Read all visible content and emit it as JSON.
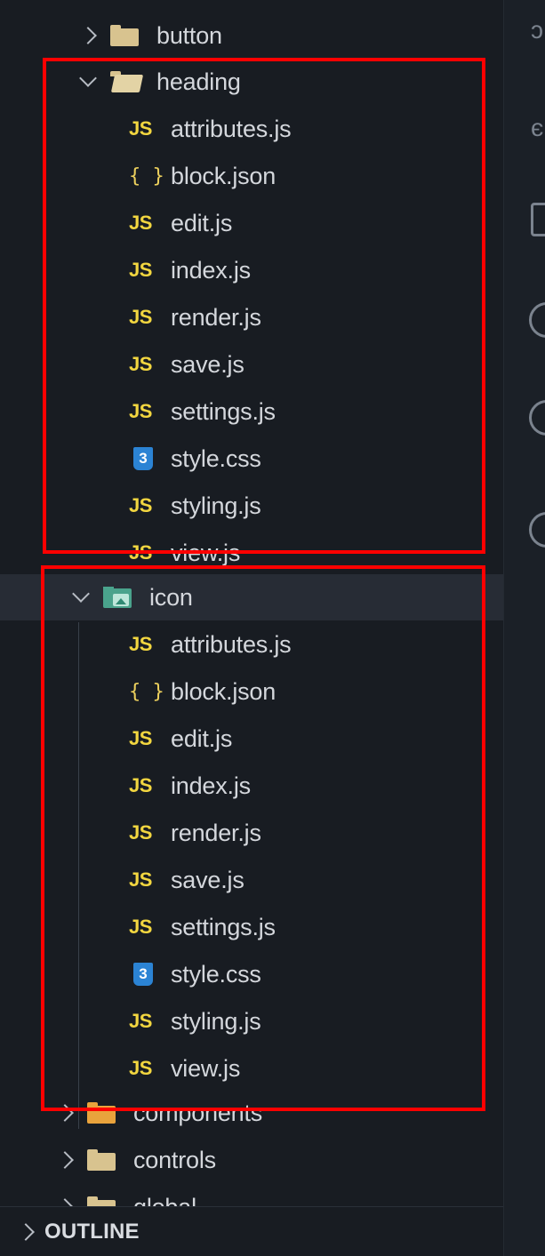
{
  "explorer": {
    "top_folder": {
      "label": "button",
      "expanded": false
    },
    "heading_folder": {
      "label": "heading",
      "expanded": true,
      "files": [
        {
          "name": "attributes.js",
          "icon": "js-icon"
        },
        {
          "name": "block.json",
          "icon": "json-icon"
        },
        {
          "name": "edit.js",
          "icon": "js-icon"
        },
        {
          "name": "index.js",
          "icon": "js-icon"
        },
        {
          "name": "render.js",
          "icon": "js-icon"
        },
        {
          "name": "save.js",
          "icon": "js-icon"
        },
        {
          "name": "settings.js",
          "icon": "js-icon"
        },
        {
          "name": "style.css",
          "icon": "css-icon"
        },
        {
          "name": "styling.js",
          "icon": "js-icon"
        },
        {
          "name": "view.js",
          "icon": "js-icon"
        }
      ]
    },
    "icon_folder": {
      "label": "icon",
      "expanded": true,
      "selected": true,
      "files": [
        {
          "name": "attributes.js",
          "icon": "js-icon"
        },
        {
          "name": "block.json",
          "icon": "json-icon"
        },
        {
          "name": "edit.js",
          "icon": "js-icon"
        },
        {
          "name": "index.js",
          "icon": "js-icon"
        },
        {
          "name": "render.js",
          "icon": "js-icon"
        },
        {
          "name": "save.js",
          "icon": "js-icon"
        },
        {
          "name": "settings.js",
          "icon": "js-icon"
        },
        {
          "name": "style.css",
          "icon": "css-icon"
        },
        {
          "name": "styling.js",
          "icon": "js-icon"
        },
        {
          "name": "view.js",
          "icon": "js-icon"
        }
      ]
    },
    "after_folders": [
      {
        "label": "components",
        "expanded": false,
        "icon": "components-folder-icon"
      },
      {
        "label": "controls",
        "expanded": false,
        "icon": "folder-icon"
      },
      {
        "label": "global",
        "expanded": false,
        "icon": "folder-icon"
      }
    ]
  },
  "icon_labels": {
    "js": "JS",
    "json": "{ }",
    "css": "3"
  },
  "outline": {
    "label": "OUTLINE"
  },
  "colors": {
    "background": "#181c22",
    "selected_row": "#272c35",
    "highlight_box": "#ff0000",
    "js_icon": "#f2d640",
    "css_icon": "#2b83d4",
    "folder": "#d8c38f"
  }
}
